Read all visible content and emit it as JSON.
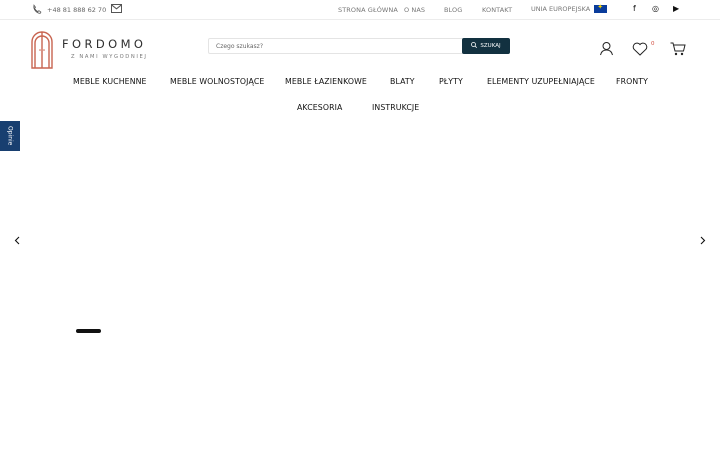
{
  "topbar": {
    "phone": "+48 81 888 62 70",
    "links": [
      "STRONA GŁÓWNA",
      "O NAS",
      "BLOG",
      "KONTAKT"
    ],
    "eu_label": "UNIA EUROPEJSKA",
    "social": [
      "f",
      "◎",
      "▶"
    ]
  },
  "brand": {
    "name": "FORDOMO",
    "tagline": "Z NAMI WYGODNIEJ",
    "accent": "#c86450"
  },
  "search": {
    "placeholder": "Czego szukasz?",
    "button": "SZUKAJ"
  },
  "header": {
    "favorites_count": "0"
  },
  "nav": {
    "items": [
      "MEBLE KUCHENNE",
      "MEBLE WOLNOSTOJĄCE",
      "MEBLE ŁAZIENKOWE",
      "BLATY",
      "PŁYTY",
      "ELEMENTY UZUPEŁNIAJĄCE",
      "FRONTY",
      "AKCESORIA",
      "INSTRUKCJE"
    ]
  },
  "sidebar_tab": {
    "label": "Opinie"
  },
  "colors": {
    "search_button": "#123140",
    "reviews_tab": "#183f70",
    "eu_flag": "#0a3c9b"
  }
}
